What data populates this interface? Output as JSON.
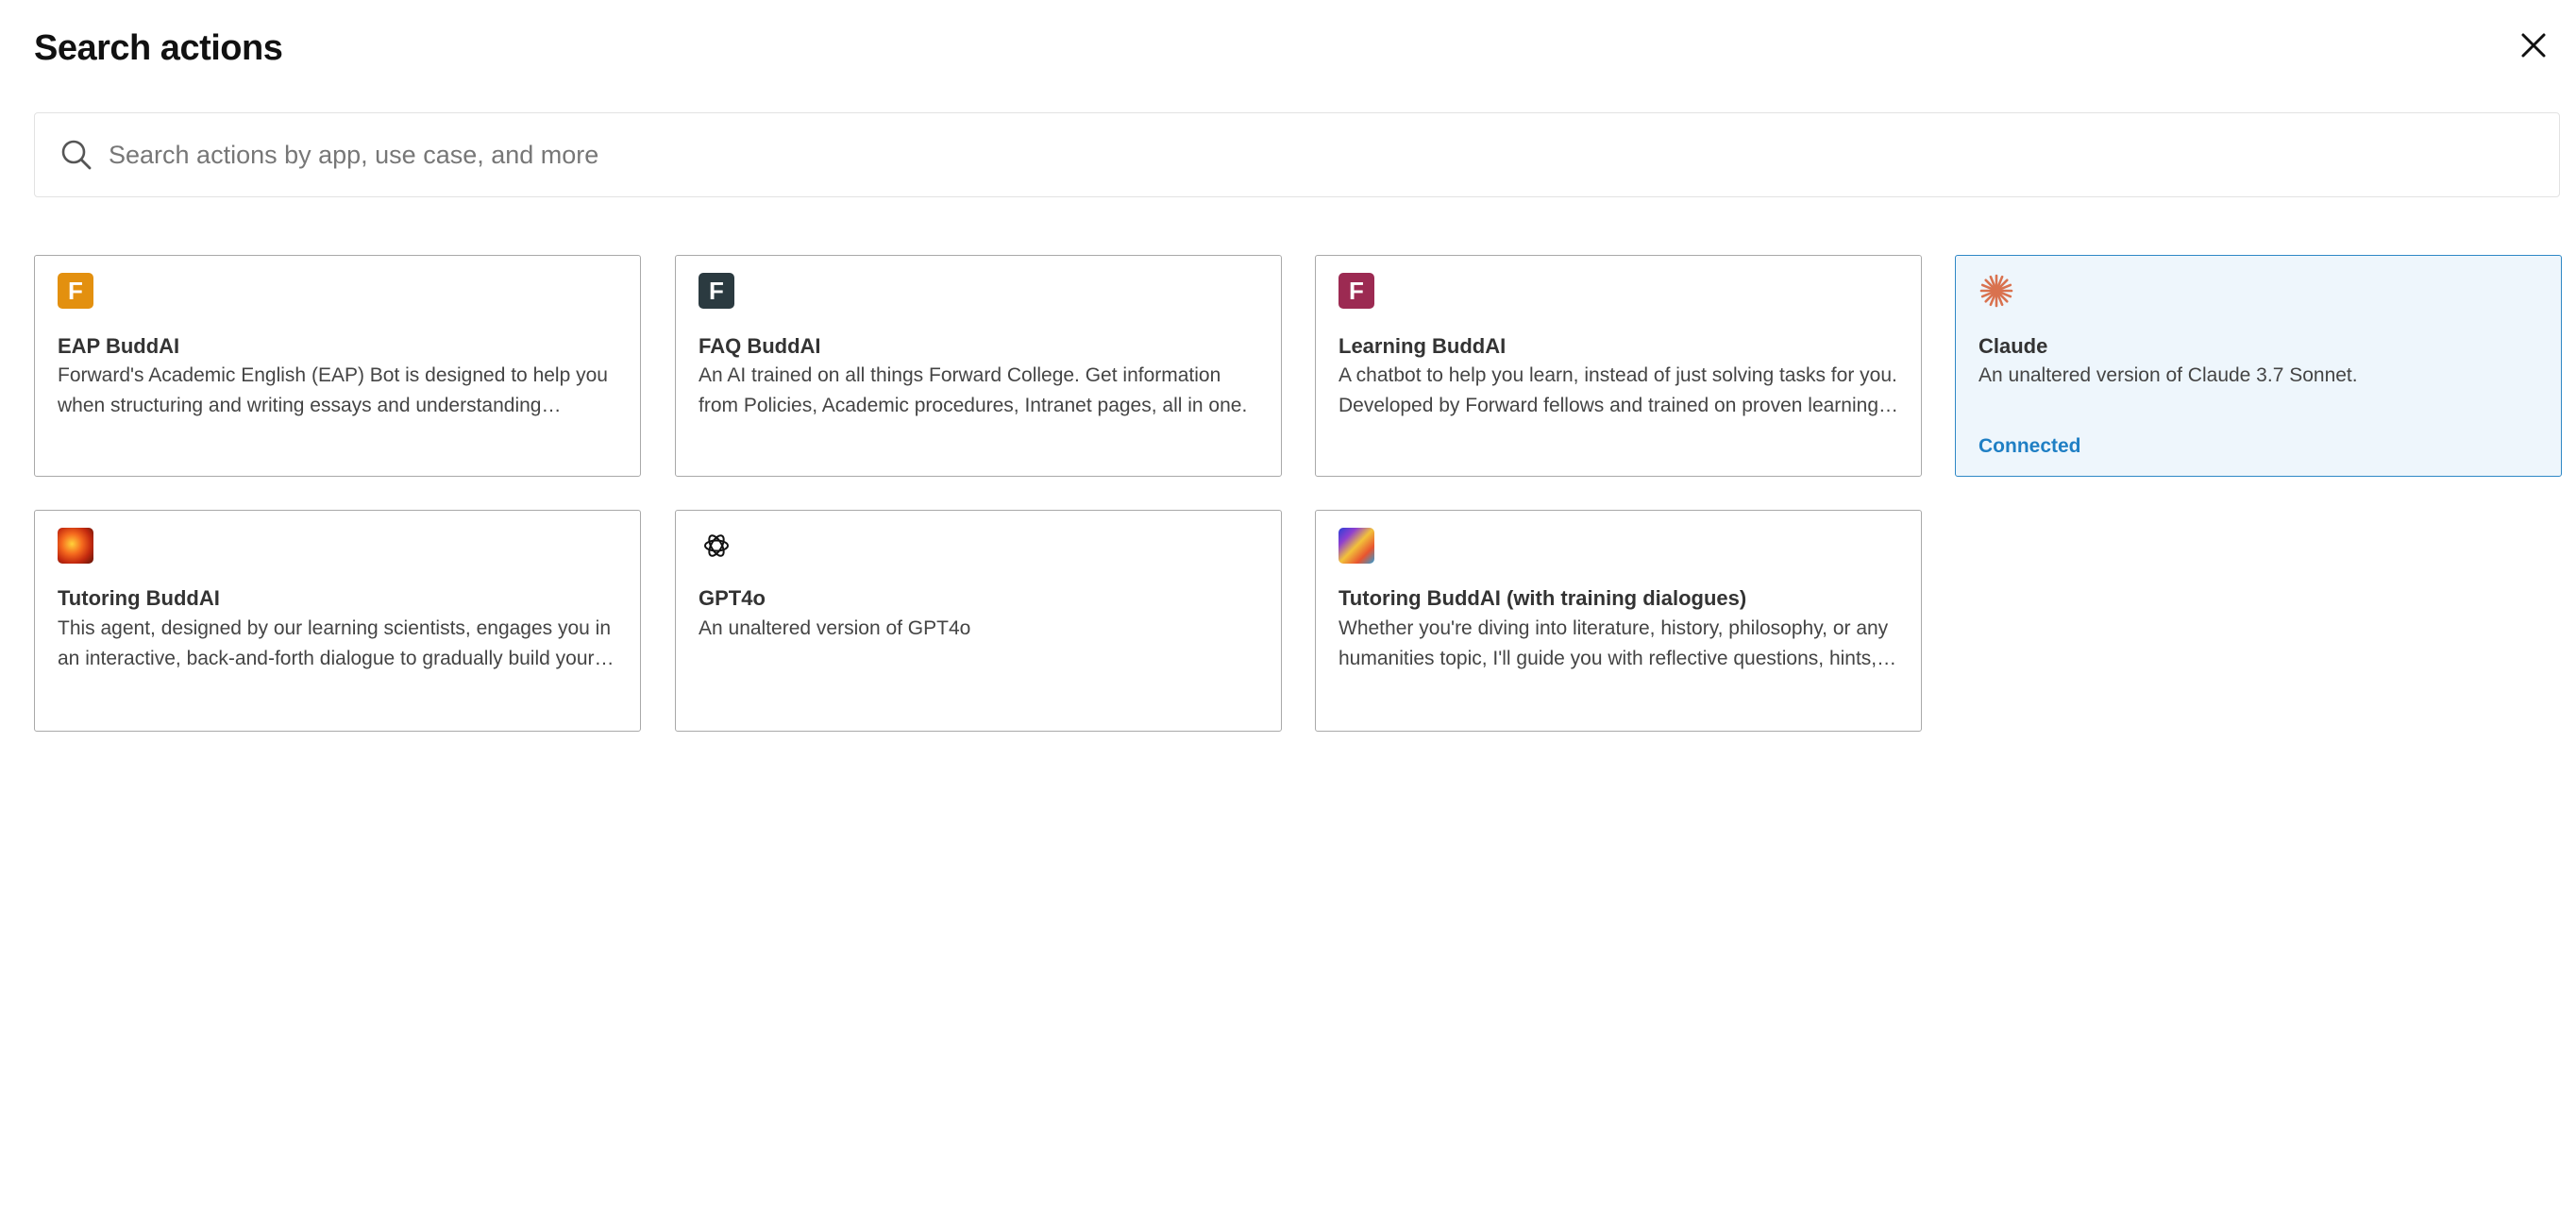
{
  "header": {
    "title": "Search actions",
    "close_icon": "close-icon"
  },
  "search": {
    "placeholder": "Search actions by app, use case, and more",
    "value": "",
    "icon": "search-icon"
  },
  "colors": {
    "connected_accent": "#1f7fc4",
    "connected_background": "#eef6fc",
    "eap_icon": "#e3900f",
    "faq_icon": "#2b3a40",
    "learning_icon": "#9c2a52",
    "claude_icon": "#d9724f"
  },
  "actions": [
    {
      "icon": "forward-logo-orange-icon",
      "icon_letter": "F",
      "title": "EAP BuddAI",
      "description": "Forward's Academic English (EAP) Bot is designed to help you when structuring and writing essays and understanding…",
      "status": ""
    },
    {
      "icon": "forward-logo-dark-icon",
      "icon_letter": "F",
      "title": "FAQ BuddAI",
      "description": "An AI trained on all things Forward College. Get information from Policies, Academic procedures, Intranet pages, all in one.",
      "status": ""
    },
    {
      "icon": "forward-logo-maroon-icon",
      "icon_letter": "F",
      "title": "Learning BuddAI",
      "description": "A chatbot to help you learn, instead of just solving tasks for you. Developed by Forward fellows and trained on proven learning…",
      "status": ""
    },
    {
      "icon": "claude-starburst-icon",
      "title": "Claude",
      "description": "An unaltered version of Claude 3.7 Sonnet.",
      "status": "Connected"
    },
    {
      "icon": "fiery-abstract-icon",
      "title": "Tutoring BuddAI",
      "description": "This agent, designed by our learning scientists, engages you in an interactive, back-and-forth dialogue to gradually build your…",
      "status": ""
    },
    {
      "icon": "openai-logo-icon",
      "title": "GPT4o",
      "description": "An unaltered version of GPT4o",
      "status": ""
    },
    {
      "icon": "colorful-abstract-icon",
      "title": "Tutoring BuddAI (with training dialogues)",
      "description": "Whether you're diving into literature, history, philosophy, or any humanities topic, I'll guide you with reflective questions, hints,…",
      "status": ""
    }
  ]
}
